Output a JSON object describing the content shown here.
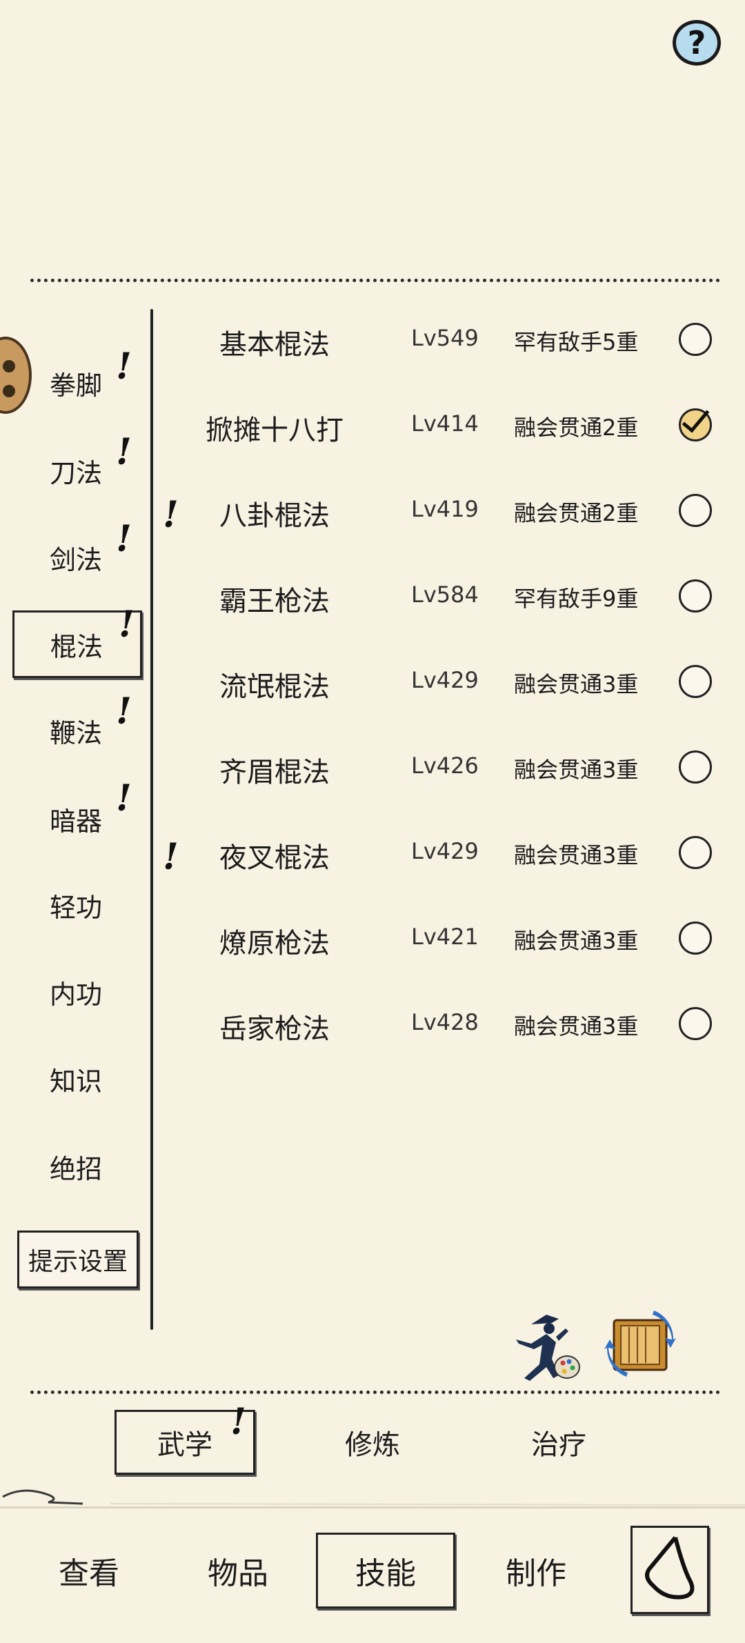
{
  "help": {
    "glyph": "?"
  },
  "categories": [
    {
      "label": "拳脚",
      "alert": "!"
    },
    {
      "label": "刀法",
      "alert": "!"
    },
    {
      "label": "剑法",
      "alert": "!"
    },
    {
      "label": "棍法",
      "alert": "!"
    },
    {
      "label": "鞭法",
      "alert": "!"
    },
    {
      "label": "暗器",
      "alert": "!"
    },
    {
      "label": "轻功"
    },
    {
      "label": "内功"
    },
    {
      "label": "知识"
    },
    {
      "label": "绝招"
    }
  ],
  "tip_settings": "提示设置",
  "skills": [
    {
      "name": "基本棍法",
      "level": "Lv549",
      "rank": "罕有敌手5重",
      "checked": false
    },
    {
      "name": "掀摊十八打",
      "level": "Lv414",
      "rank": "融会贯通2重",
      "checked": true
    },
    {
      "name": "八卦棍法",
      "level": "Lv419",
      "rank": "融会贯通2重",
      "checked": false,
      "alert": "!"
    },
    {
      "name": "霸王枪法",
      "level": "Lv584",
      "rank": "罕有敌手9重",
      "checked": false
    },
    {
      "name": "流氓棍法",
      "level": "Lv429",
      "rank": "融会贯通3重",
      "checked": false
    },
    {
      "name": "齐眉棍法",
      "level": "Lv426",
      "rank": "融会贯通3重",
      "checked": false
    },
    {
      "name": "夜叉棍法",
      "level": "Lv429",
      "rank": "融会贯通3重",
      "checked": false,
      "alert": "!"
    },
    {
      "name": "燎原枪法",
      "level": "Lv421",
      "rank": "融会贯通3重",
      "checked": false
    },
    {
      "name": "岳家枪法",
      "level": "Lv428",
      "rank": "融会贯通3重",
      "checked": false
    }
  ],
  "subtabs": [
    {
      "label": "武学",
      "alert": "!"
    },
    {
      "label": "修炼"
    },
    {
      "label": "治疗"
    }
  ],
  "nav": [
    {
      "label": "查看"
    },
    {
      "label": "物品"
    },
    {
      "label": "技能"
    },
    {
      "label": "制作"
    }
  ],
  "icons": {
    "fighter": "fighter-palette-icon",
    "swap": "scroll-swap-icon",
    "back": "back-arrow-icon"
  },
  "colors": {
    "background": "#f8f2e3",
    "help_fill": "#b8dcef",
    "check_fill": "#f1d48a"
  }
}
